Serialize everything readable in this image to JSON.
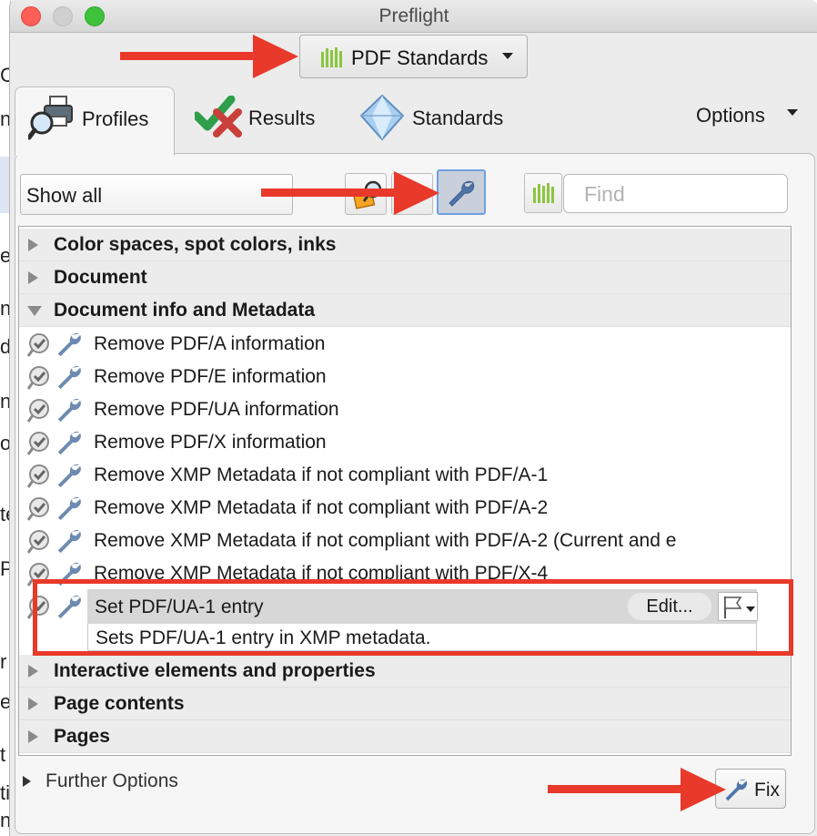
{
  "window": {
    "title": "Preflight"
  },
  "background_window": {
    "letters": [
      "C",
      "n",
      "e",
      "n",
      "d",
      "n",
      "op",
      "te",
      "P",
      "r",
      "e",
      "t",
      "ti",
      "n"
    ]
  },
  "standards_dropdown": {
    "label": "PDF Standards"
  },
  "tabs": [
    {
      "label": "Profiles",
      "icon": "magnifier-printer-icon",
      "selected": true
    },
    {
      "label": "Results",
      "icon": "check-cross-icon"
    },
    {
      "label": "Standards",
      "icon": "diamond-icon"
    }
  ],
  "options_label": "Options",
  "filter": {
    "value": "Show all"
  },
  "find": {
    "placeholder": "Find"
  },
  "categories": {
    "color": "Color spaces, spot colors, inks",
    "document": "Document",
    "metadata": "Document info and Metadata",
    "interactive": "Interactive elements and properties",
    "page_contents": "Page contents",
    "pages": "Pages"
  },
  "fixups": [
    "Remove PDF/A information",
    "Remove PDF/E information",
    "Remove PDF/UA information",
    "Remove PDF/X information",
    "Remove XMP Metadata if not compliant with PDF/A-1",
    "Remove XMP Metadata if not compliant with PDF/A-2",
    "Remove XMP Metadata if not compliant with PDF/A-2 (Current and e",
    "Remove XMP Metadata if not compliant with PDF/X-4"
  ],
  "selected_fixup": {
    "label": "Set PDF/UA-1 entry",
    "edit_label": "Edit...",
    "description": "Sets PDF/UA-1 entry in XMP metadata."
  },
  "further_options": "Further Options",
  "fix_button": "Fix",
  "colors": {
    "annotation": "#e8392a",
    "accent_green": "#8cc63f",
    "wrench": "#6d8bb0"
  }
}
